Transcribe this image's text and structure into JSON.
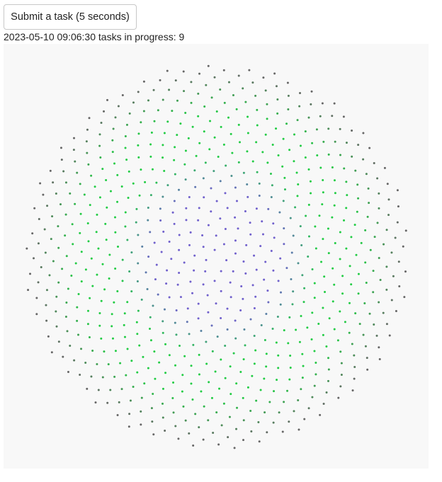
{
  "toolbar": {
    "submit_label": "Submit a task (5 seconds)"
  },
  "status": {
    "timestamp": "2023-05-10 09:06:30",
    "tasks_label": "tasks in progress:",
    "tasks_count": "9"
  },
  "canvas": {
    "background": "#f8f8f8",
    "pattern": "phyllotaxis-spiral-dots",
    "dot_count": 780,
    "colors": {
      "center": "#7060cc",
      "middle": "#22cc44",
      "outer": "#666666"
    }
  }
}
